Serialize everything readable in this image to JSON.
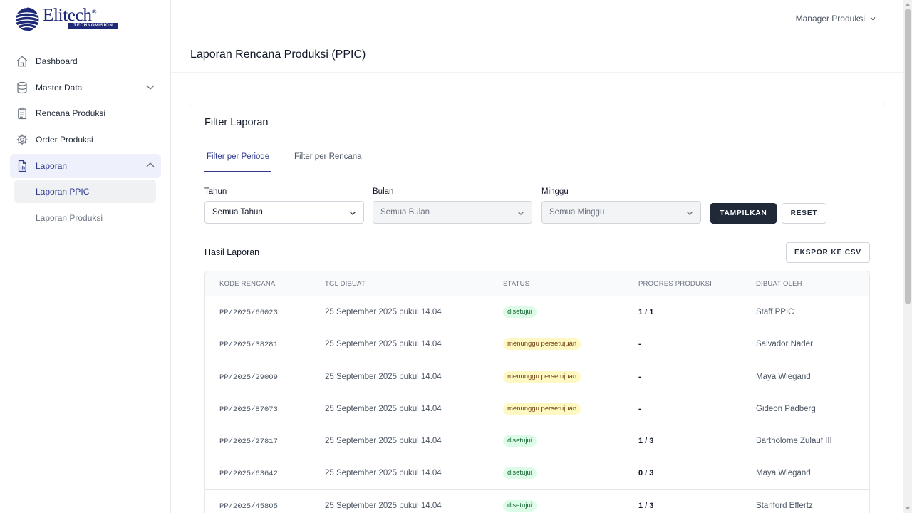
{
  "brand": {
    "name": "Elitech",
    "reg": "®",
    "tagline": "TECHNOVISION"
  },
  "sidebar": {
    "items": [
      {
        "label": "Dashboard",
        "icon": "home-icon"
      },
      {
        "label": "Master Data",
        "icon": "database-icon",
        "expandable": true,
        "expanded": false
      },
      {
        "label": "Rencana Produksi",
        "icon": "clipboard-icon"
      },
      {
        "label": "Order Produksi",
        "icon": "gear-icon"
      },
      {
        "label": "Laporan",
        "icon": "report-icon",
        "expandable": true,
        "expanded": true,
        "active": true
      }
    ],
    "subitems": [
      {
        "label": "Laporan PPIC",
        "active": true
      },
      {
        "label": "Laporan Produksi",
        "active": false
      }
    ]
  },
  "topbar": {
    "user": "Manager Produksi"
  },
  "page": {
    "title": "Laporan Rencana Produksi (PPIC)"
  },
  "filter": {
    "title": "Filter Laporan",
    "tabs": [
      {
        "label": "Filter per Periode",
        "active": true
      },
      {
        "label": "Filter per Rencana",
        "active": false
      }
    ],
    "year": {
      "label": "Tahun",
      "value": "Semua Tahun"
    },
    "month": {
      "label": "Bulan",
      "value": "Semua Bulan"
    },
    "week": {
      "label": "Minggu",
      "value": "Semua Minggu"
    },
    "show_label": "TAMPILKAN",
    "reset_label": "RESET"
  },
  "results": {
    "title": "Hasil Laporan",
    "export_label": "EKSPOR KE CSV",
    "columns": [
      "KODE RENCANA",
      "TGL DIBUAT",
      "STATUS",
      "PROGRES PRODUKSI",
      "DIBUAT OLEH"
    ],
    "rows": [
      {
        "code": "PP/2025/66023",
        "date": "25 September 2025 pukul 14.04",
        "status": "disetujui",
        "progress": "1 / 1",
        "by": "Staff PPIC"
      },
      {
        "code": "PP/2025/38281",
        "date": "25 September 2025 pukul 14.04",
        "status": "menunggu persetujuan",
        "progress": "-",
        "by": "Salvador Nader"
      },
      {
        "code": "PP/2025/29009",
        "date": "25 September 2025 pukul 14.04",
        "status": "menunggu persetujuan",
        "progress": "-",
        "by": "Maya Wiegand"
      },
      {
        "code": "PP/2025/87073",
        "date": "25 September 2025 pukul 14.04",
        "status": "menunggu persetujuan",
        "progress": "-",
        "by": "Gideon Padberg"
      },
      {
        "code": "PP/2025/27817",
        "date": "25 September 2025 pukul 14.04",
        "status": "disetujui",
        "progress": "1 / 3",
        "by": "Bartholome Zulauf III"
      },
      {
        "code": "PP/2025/63642",
        "date": "25 September 2025 pukul 14.04",
        "status": "disetujui",
        "progress": "0 / 3",
        "by": "Maya Wiegand"
      },
      {
        "code": "PP/2025/45805",
        "date": "25 September 2025 pukul 14.04",
        "status": "disetujui",
        "progress": "1 / 3",
        "by": "Stanford Effertz"
      }
    ]
  },
  "colors": {
    "accent": "#2f3a8f",
    "brand": "#1e2a78",
    "approved_bg": "#dcfce7",
    "pending_bg": "#fef9c3",
    "dark_button": "#1f2937"
  }
}
